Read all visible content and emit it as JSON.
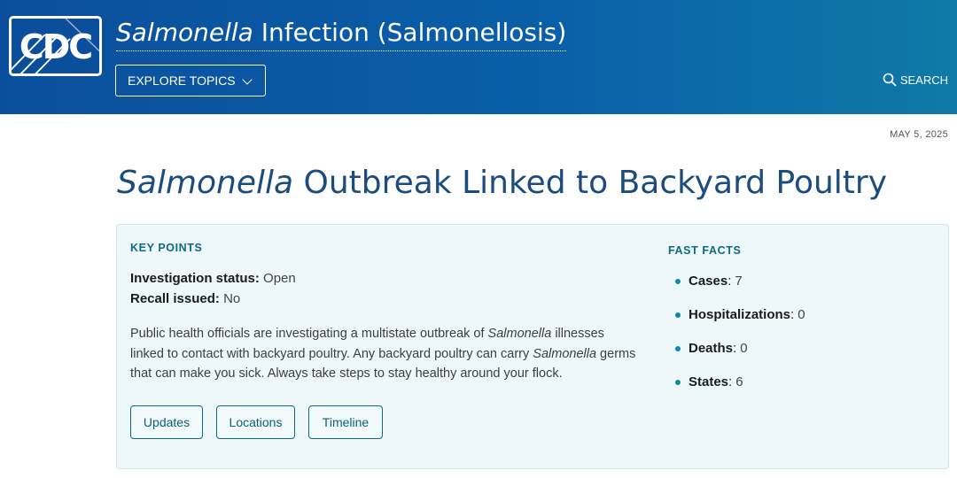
{
  "header": {
    "logo_text": "CDC",
    "title_italic": "Salmonella",
    "title_rest": " Infection (Salmonellosis)",
    "explore_label": "EXPLORE TOPICS",
    "search_label": "SEARCH"
  },
  "date": "MAY 5, 2025",
  "page_title": {
    "italic": "Salmonella",
    "rest": " Outbreak Linked to Backyard Poultry"
  },
  "key_points": {
    "heading": "KEY POINTS",
    "status_label": "Investigation status:",
    "status_value": "Open",
    "recall_label": "Recall issued:",
    "recall_value": "No",
    "para_1": "Public health officials are investigating a multistate outbreak of ",
    "para_italic_1": "Salmonella",
    "para_2": " illnesses linked to contact with backyard poultry. Any backyard poultry can carry ",
    "para_italic_2": "Salmonella",
    "para_3": " germs that can make you sick. Always take steps to stay healthy around your flock.",
    "buttons": [
      "Updates",
      "Locations",
      "Timeline"
    ]
  },
  "fast_facts": {
    "heading": "FAST FACTS",
    "items": [
      {
        "label": "Cases",
        "value": "7"
      },
      {
        "label": "Hospitalizations",
        "value": "0"
      },
      {
        "label": "Deaths",
        "value": "0"
      },
      {
        "label": "States",
        "value": "6"
      }
    ]
  },
  "colors": {
    "header_start": "#0b4f9c",
    "header_end": "#0f7aa7",
    "title_blue": "#1a4c7e",
    "teal_accent": "#0a6b84",
    "card_bg": "#eef8fb"
  }
}
